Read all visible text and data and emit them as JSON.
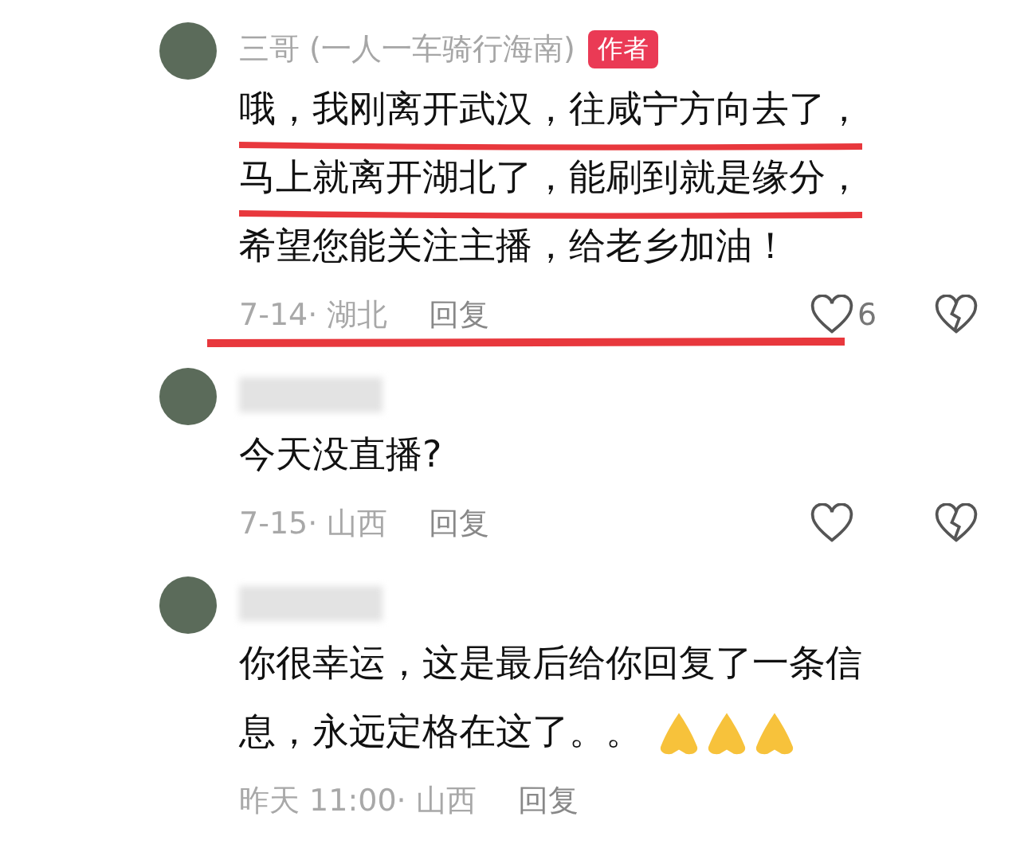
{
  "comments": [
    {
      "author": "三哥 (一人一车骑行海南)",
      "badge": "作者",
      "lines": [
        {
          "text": "哦，我刚离开武汉，往咸宁方向去了，",
          "underlined": true
        },
        {
          "text": "马上就离开湖北了，能刷到就是缘分，",
          "underlined": true
        },
        {
          "text": "希望您能关注主播，给老乡加油！"
        }
      ],
      "meta": "7-14· 湖北",
      "reply": "回复",
      "meta_underlined": true,
      "show_actions": true,
      "likes": "6"
    },
    {
      "lines": [
        {
          "text": "今天没直播?"
        }
      ],
      "meta": "7-15· 山西",
      "reply": "回复",
      "show_actions": true
    },
    {
      "lines": [
        {
          "text": "你很幸运，这是最后给你回复了一条信"
        },
        {
          "text": "息，永远定格在这了。。"
        }
      ],
      "emojis": [
        {
          "kind": "pray"
        },
        {
          "kind": "pray"
        },
        {
          "kind": "pray"
        }
      ],
      "meta": "昨天 11:00· 山西",
      "reply": "回复"
    }
  ]
}
